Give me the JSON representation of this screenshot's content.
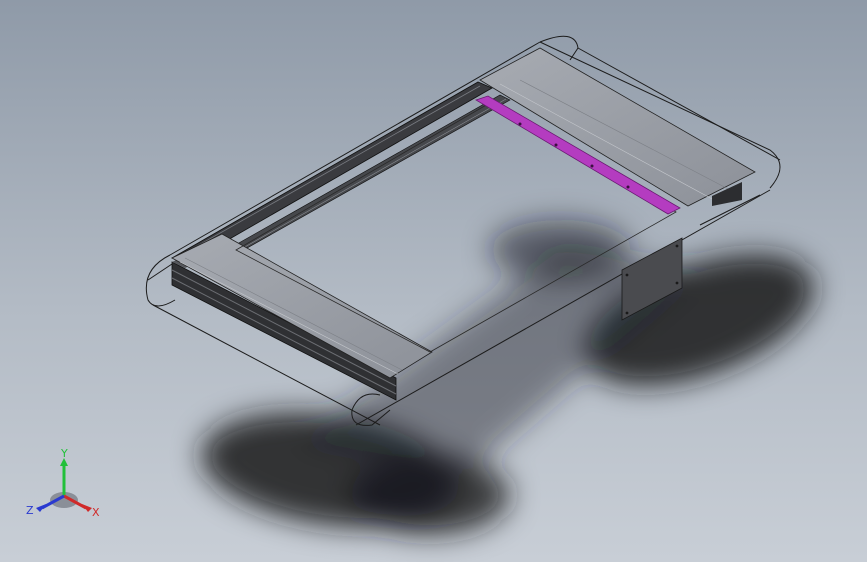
{
  "viewport": {
    "background_top": "#8f9aa8",
    "background_bottom": "#c8ced6"
  },
  "model": {
    "frame_color": "#3c3d40",
    "plate_color": "#9fa3aa",
    "highlight_color": "#b43cc0",
    "panel_color": "#4a4b4f"
  },
  "triad": {
    "y_label": "Y",
    "x_label": "X",
    "z_label": "Z",
    "y_color": "#22c03a",
    "x_color": "#d02a2a",
    "z_color": "#2a3ad0"
  }
}
